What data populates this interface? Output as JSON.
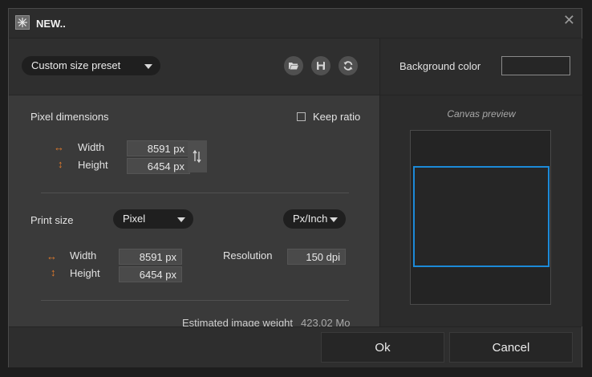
{
  "window": {
    "title": "NEW..",
    "close_glyph": "✕"
  },
  "preset": {
    "selected": "Custom size preset",
    "icons": [
      "open-folder-icon",
      "save-icon",
      "refresh-icon"
    ]
  },
  "background": {
    "label": "Background color",
    "color": "#262626"
  },
  "pixel_dimensions": {
    "heading": "Pixel dimensions",
    "keep_ratio_label": "Keep ratio",
    "keep_ratio_checked": false,
    "width_label": "Width",
    "width_value": "8591 px",
    "height_label": "Height",
    "height_value": "6454 px"
  },
  "print_size": {
    "heading": "Print size",
    "unit_selected": "Pixel",
    "resolution_unit_selected": "Px/Inch",
    "width_label": "Width",
    "width_value": "8591 px",
    "height_label": "Height",
    "height_value": "6454 px",
    "resolution_label": "Resolution",
    "resolution_value": "150 dpi"
  },
  "estimate": {
    "label": "Estimated image weight",
    "value": "423.02 Mo"
  },
  "preview": {
    "label": "Canvas preview"
  },
  "footer": {
    "ok_label": "Ok",
    "cancel_label": "Cancel"
  },
  "colors": {
    "accent_orange": "#e07a2c",
    "preview_border": "#1c8ad8"
  }
}
